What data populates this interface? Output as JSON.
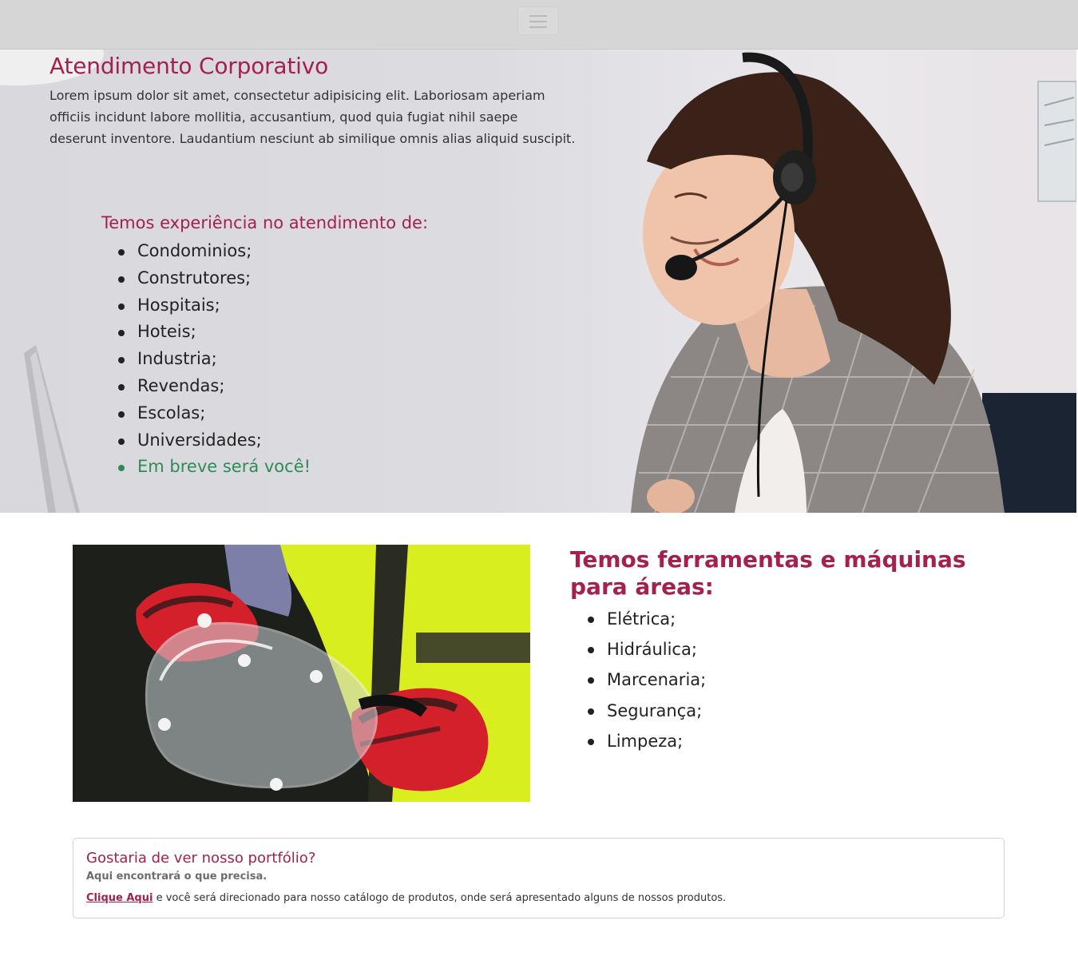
{
  "navbar": {
    "toggler_icon": "hamburger-menu-icon"
  },
  "hero": {
    "title": "Atendimento Corporativo",
    "text": "Lorem ipsum dolor sit amet, consectetur adipisicing elit. Laboriosam aperiam officiis incidunt labore mollitia, accusantium, quod quia fugiat nihil saepe deserunt inventore. Laudantium nesciunt ab similique omnis alias aliquid suscipit.",
    "experience_title": "Temos experiência no atendimento de:",
    "experience_items": [
      "Condominios;",
      "Construtores;",
      "Hospitais;",
      "Hoteis;",
      "Industria;",
      "Revendas;",
      "Escolas;",
      "Universidades;",
      "Em breve será você!"
    ],
    "colors": {
      "accent": "#a3204f",
      "highlight": "#2e8b57"
    }
  },
  "tools": {
    "title": "Temos ferramentas e máquinas para áreas:",
    "items": [
      "Elétrica;",
      "Hidráulica;",
      "Marcenaria;",
      "Segurança;",
      "Limpeza;"
    ]
  },
  "card": {
    "title": "Gostaria de ver nosso portfólio?",
    "subtitle": "Aqui encontrará o que precisa.",
    "link_label": "Clique Aqui",
    "text": " e você será direcionado para nosso catálogo de produtos, onde será apresentado alguns de nossos produtos."
  }
}
